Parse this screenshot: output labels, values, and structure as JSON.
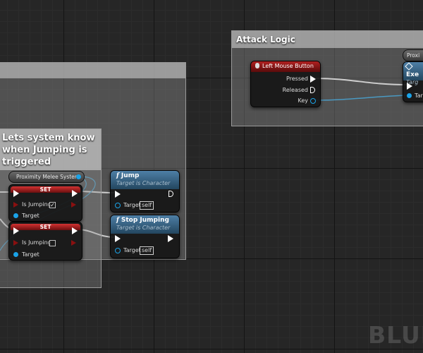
{
  "comments": {
    "left": {
      "title": ""
    },
    "jump_note": {
      "text_lines": [
        "Lets system know",
        "when Jumping is",
        "triggered"
      ]
    },
    "attack": {
      "title": "Attack Logic"
    }
  },
  "variable_node": {
    "label": "Proximity Melee System"
  },
  "set_nodes": [
    {
      "title": "SET",
      "field_label": "Is Jumping",
      "checked": "✓",
      "target_label": "Target"
    },
    {
      "title": "SET",
      "field_label": "Is Jumping",
      "checked": "",
      "target_label": "Target"
    }
  ],
  "function_nodes": {
    "jump": {
      "glyph": "f",
      "title": "Jump",
      "subtitle": "Target is Character",
      "target_label": "Target",
      "self_label": "self"
    },
    "stop_jumping": {
      "glyph": "f",
      "title": "Stop Jumping",
      "subtitle": "Target is Character",
      "target_label": "Target",
      "self_label": "self"
    }
  },
  "event_node": {
    "title": "Left Mouse Button",
    "pins": [
      "Pressed",
      "Released",
      "Key"
    ]
  },
  "partial_node": {
    "header": "Proxi",
    "title": "Exe",
    "subtitle": "Targ",
    "target_label": "Tar"
  },
  "watermark": "BLUE",
  "colors": {
    "exec_wire": "#ffffff",
    "object_wire": "#1aa3e8",
    "bool_pin": "#8a1010",
    "function_header": "#3b6a8c",
    "event_header": "#8c1a1a"
  }
}
